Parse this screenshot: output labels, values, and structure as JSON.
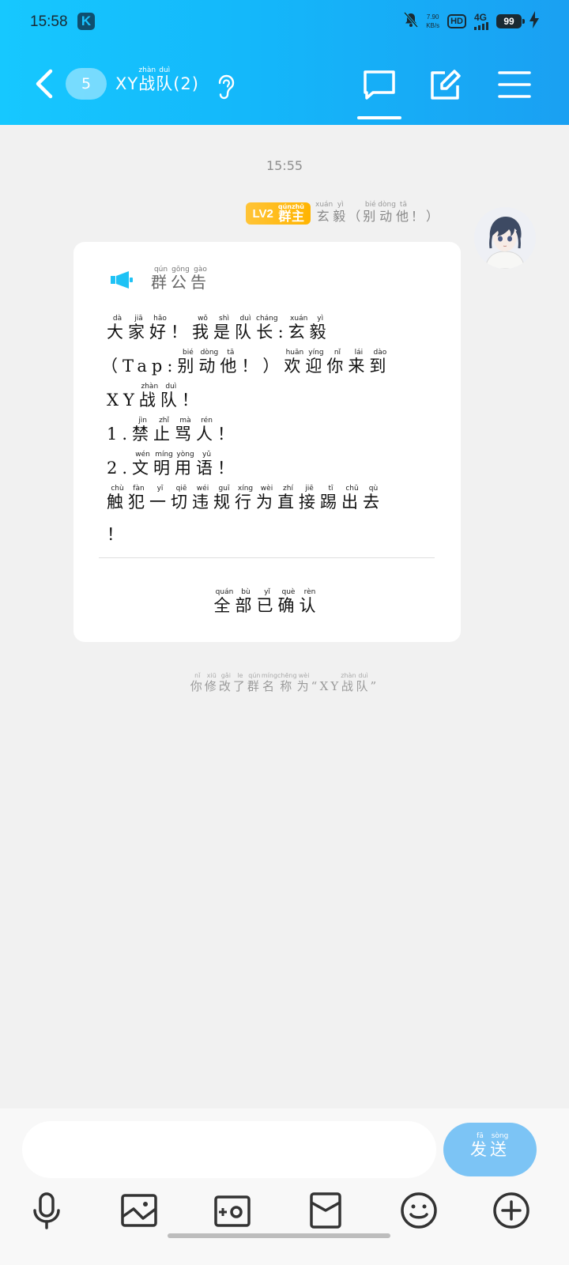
{
  "status_bar": {
    "time": "15:58",
    "app_badge": "K",
    "net_speed_value": "7.90",
    "net_speed_unit": "KB/s",
    "hd_label": "HD",
    "network_label": "4G",
    "battery": "99"
  },
  "header": {
    "unread_count": "5",
    "title_prefix": "XY",
    "title_chars": [
      {
        "char": "战",
        "pinyin": "zhàn"
      },
      {
        "char": "队",
        "pinyin": "duì"
      }
    ],
    "title_suffix": "(2)"
  },
  "chat": {
    "timestamp": "15:55",
    "sender": {
      "level": "LV2",
      "role_chars": [
        {
          "char": "群",
          "pinyin": "qún"
        },
        {
          "char": "主",
          "pinyin": "zhǔ"
        }
      ],
      "name_chars": [
        {
          "char": "玄",
          "pinyin": "xuán"
        },
        {
          "char": "毅",
          "pinyin": "yì"
        },
        {
          "char": "（",
          "pinyin": ""
        },
        {
          "char": "别",
          "pinyin": "bié"
        },
        {
          "char": "动",
          "pinyin": "dòng"
        },
        {
          "char": "他",
          "pinyin": "tā"
        },
        {
          "char": "！",
          "pinyin": ""
        },
        {
          "char": "）",
          "pinyin": ""
        }
      ]
    },
    "notice": {
      "title_chars": [
        {
          "char": "群",
          "pinyin": "qún"
        },
        {
          "char": "公",
          "pinyin": "gōng"
        },
        {
          "char": "告",
          "pinyin": "gào"
        }
      ],
      "lines": [
        [
          {
            "char": "大",
            "pinyin": "dà"
          },
          {
            "char": "家",
            "pinyin": "jiā"
          },
          {
            "char": "好",
            "pinyin": "hǎo"
          },
          {
            "char": "！",
            "pinyin": ""
          },
          {
            "char": "我",
            "pinyin": "wǒ"
          },
          {
            "char": "是",
            "pinyin": "shì"
          },
          {
            "char": "队",
            "pinyin": "duì"
          },
          {
            "char": "长",
            "pinyin": "cháng"
          },
          {
            "char": ":",
            "pinyin": ""
          },
          {
            "char": "玄",
            "pinyin": "xuán"
          },
          {
            "char": "毅",
            "pinyin": "yì"
          }
        ],
        [
          {
            "char": "（",
            "pinyin": ""
          },
          {
            "char": "Tap:",
            "pinyin": ""
          },
          {
            "char": "别",
            "pinyin": "bié"
          },
          {
            "char": "动",
            "pinyin": "dòng"
          },
          {
            "char": "他",
            "pinyin": "tā"
          },
          {
            "char": "！",
            "pinyin": ""
          },
          {
            "char": "）",
            "pinyin": ""
          },
          {
            "char": "欢",
            "pinyin": "huān"
          },
          {
            "char": "迎",
            "pinyin": "yíng"
          },
          {
            "char": "你",
            "pinyin": "nǐ"
          },
          {
            "char": "来",
            "pinyin": "lái"
          },
          {
            "char": "到",
            "pinyin": "dào"
          }
        ],
        [
          {
            "char": "XY",
            "pinyin": ""
          },
          {
            "char": "战",
            "pinyin": "zhàn"
          },
          {
            "char": "队",
            "pinyin": "duì"
          },
          {
            "char": "！",
            "pinyin": ""
          }
        ],
        [
          {
            "char": "1.",
            "pinyin": ""
          },
          {
            "char": "禁",
            "pinyin": "jìn"
          },
          {
            "char": "止",
            "pinyin": "zhǐ"
          },
          {
            "char": "骂",
            "pinyin": "mà"
          },
          {
            "char": "人",
            "pinyin": "rén"
          },
          {
            "char": "！",
            "pinyin": ""
          }
        ],
        [
          {
            "char": "2.",
            "pinyin": ""
          },
          {
            "char": "文",
            "pinyin": "wén"
          },
          {
            "char": "明",
            "pinyin": "míng"
          },
          {
            "char": "用",
            "pinyin": "yòng"
          },
          {
            "char": "语",
            "pinyin": "yǔ"
          },
          {
            "char": "！",
            "pinyin": ""
          }
        ],
        [
          {
            "char": "触",
            "pinyin": "chù"
          },
          {
            "char": "犯",
            "pinyin": "fàn"
          },
          {
            "char": "一",
            "pinyin": "yī"
          },
          {
            "char": "切",
            "pinyin": "qiē"
          },
          {
            "char": "违",
            "pinyin": "wéi"
          },
          {
            "char": "规",
            "pinyin": "guī"
          },
          {
            "char": "行",
            "pinyin": "xíng"
          },
          {
            "char": "为",
            "pinyin": "wèi"
          },
          {
            "char": "直",
            "pinyin": "zhí"
          },
          {
            "char": "接",
            "pinyin": "jiē"
          },
          {
            "char": "踢",
            "pinyin": "tī"
          },
          {
            "char": "出",
            "pinyin": "chū"
          },
          {
            "char": "去",
            "pinyin": "qù"
          }
        ],
        [
          {
            "char": "！",
            "pinyin": ""
          }
        ]
      ],
      "confirm_chars": [
        {
          "char": "全",
          "pinyin": "quán"
        },
        {
          "char": "部",
          "pinyin": "bù"
        },
        {
          "char": "已",
          "pinyin": "yǐ"
        },
        {
          "char": "确",
          "pinyin": "què"
        },
        {
          "char": "认",
          "pinyin": "rèn"
        }
      ]
    },
    "system_message_chars": [
      {
        "char": "你",
        "pinyin": "nǐ"
      },
      {
        "char": "修",
        "pinyin": "xiū"
      },
      {
        "char": "改",
        "pinyin": "gǎi"
      },
      {
        "char": "了",
        "pinyin": "le"
      },
      {
        "char": "群",
        "pinyin": "qún"
      },
      {
        "char": "名",
        "pinyin": "míng"
      },
      {
        "char": "称",
        "pinyin": "chēng"
      },
      {
        "char": "为",
        "pinyin": "wèi"
      },
      {
        "char": "“XY",
        "pinyin": ""
      },
      {
        "char": "战",
        "pinyin": "zhàn"
      },
      {
        "char": "队",
        "pinyin": "duì"
      },
      {
        "char": "”",
        "pinyin": ""
      }
    ]
  },
  "input": {
    "value": "",
    "send_chars": [
      {
        "char": "发",
        "pinyin": "fā"
      },
      {
        "char": "送",
        "pinyin": "sòng"
      }
    ]
  },
  "toolbar_icons": [
    "microphone-icon",
    "image-icon",
    "camera-icon",
    "red-packet-icon",
    "emoji-icon",
    "plus-icon"
  ],
  "colors": {
    "header_start": "#16c8ff",
    "header_end": "#1aa0f2",
    "badge": "#ffb400",
    "send_button": "#7cc4f5",
    "announce_icon": "#1ec2f5"
  }
}
